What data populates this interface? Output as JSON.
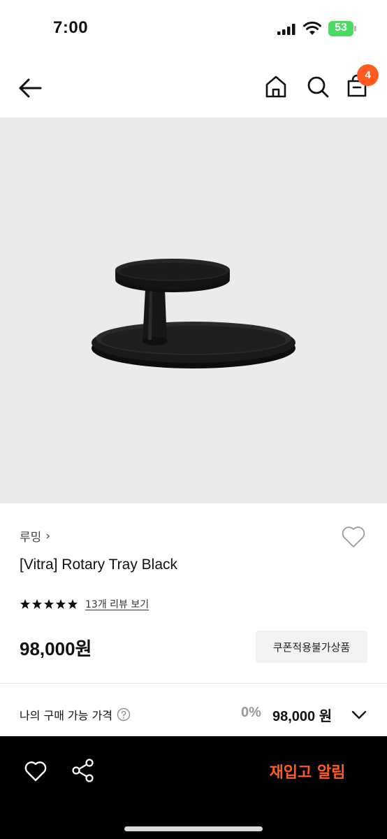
{
  "status_bar": {
    "time": "7:00",
    "battery": "53"
  },
  "header": {
    "icons": [
      "back-arrow-icon",
      "home-icon",
      "search-icon",
      "cart-icon"
    ],
    "cart_count": "4"
  },
  "product": {
    "image": "rotary-tray-image",
    "brand": "루밍",
    "title": "[Vitra] Rotary Tray Black",
    "rating_stars": 5,
    "review_link": "13개 리뷰 보기",
    "price": "98,000원",
    "coupon_badge": "쿠폰적용불가상품"
  },
  "my_price": {
    "label": "나의 구매 가능 가격",
    "discount": "0%",
    "price": "98,000 원"
  },
  "bottom_bar": {
    "restock_label": "재입고 알림"
  },
  "colors": {
    "accent": "#ff5a1f",
    "bottom_bar": "#000000",
    "image_bg": "#ebebeb",
    "battery": "#4cd964"
  }
}
